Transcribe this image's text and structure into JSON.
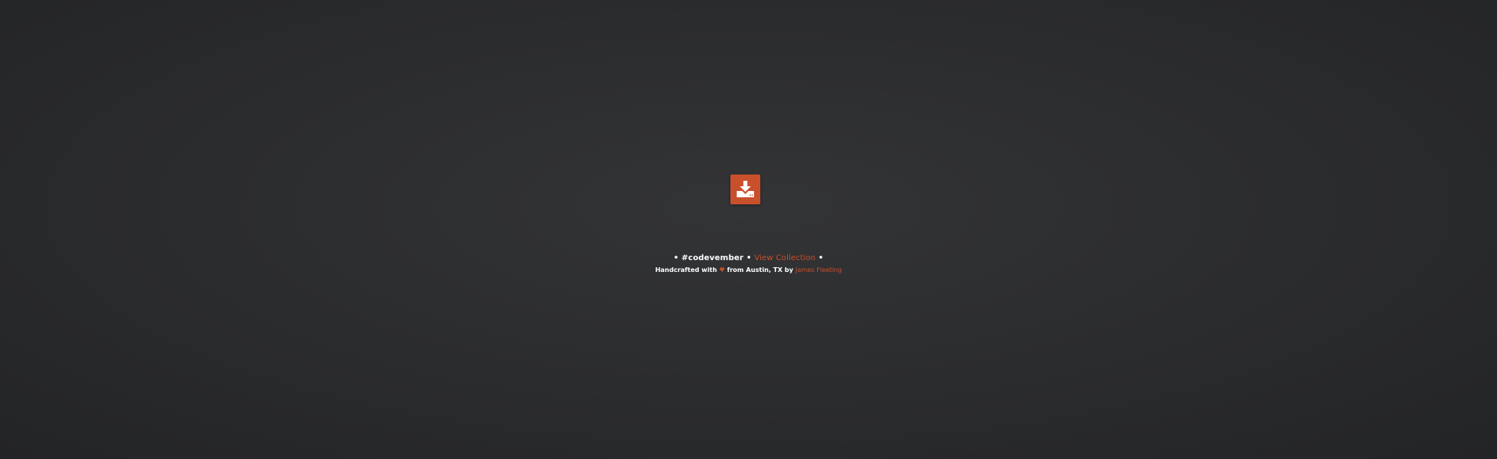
{
  "download_button": {
    "icon": "download-icon",
    "color": "#c8502c"
  },
  "footer": {
    "bullet_left": "•",
    "hashtag": "#codevember",
    "bullet_mid": "•",
    "collection_link": "View Collection",
    "bullet_right": "•",
    "handcrafted_prefix": "Handcrafted with",
    "heart_icon": "heart-icon",
    "heart_glyph": "♥",
    "location_text": "from Austin, TX by",
    "author_link": "James Fleeting"
  }
}
